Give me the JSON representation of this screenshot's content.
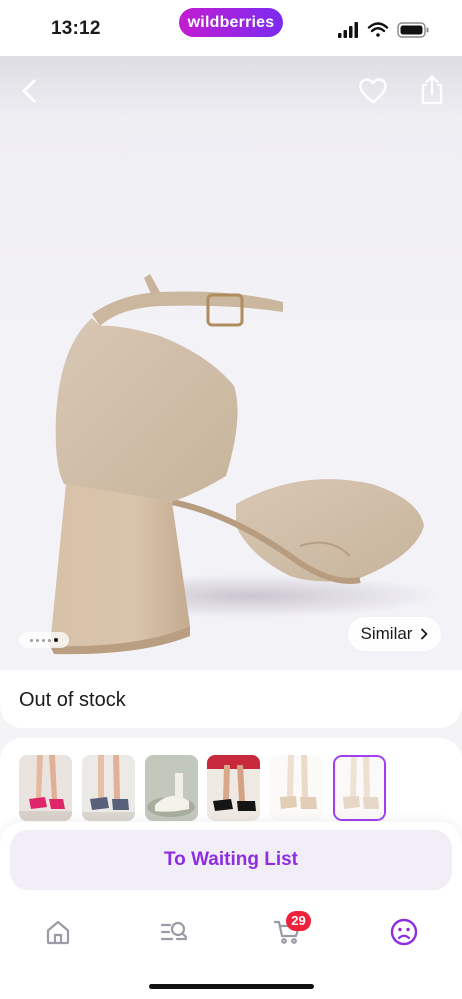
{
  "status_bar": {
    "time": "13:12",
    "brand": "wildberries"
  },
  "header": {
    "back_icon": "chevron-left-icon",
    "favorite_icon": "heart-icon",
    "share_icon": "share-icon"
  },
  "gallery": {
    "image_count": 5,
    "active_index": 4,
    "similar_label": "Similar"
  },
  "stock": {
    "status": "Out of stock"
  },
  "variants": {
    "selected_index": 5,
    "items": [
      {
        "name": "pink-heel"
      },
      {
        "name": "grey-heel"
      },
      {
        "name": "white-heel"
      },
      {
        "name": "black-heel"
      },
      {
        "name": "beige-heel"
      },
      {
        "name": "nude-heel"
      }
    ]
  },
  "actions": {
    "waiting_list_label": "To Waiting List"
  },
  "tabbar": {
    "cart_count": "29",
    "accent": "#8e2ee0"
  },
  "colors": {
    "brand_gradient_start": "#c21dd0",
    "brand_gradient_end": "#7b2bf0",
    "badge": "#f0213a"
  }
}
